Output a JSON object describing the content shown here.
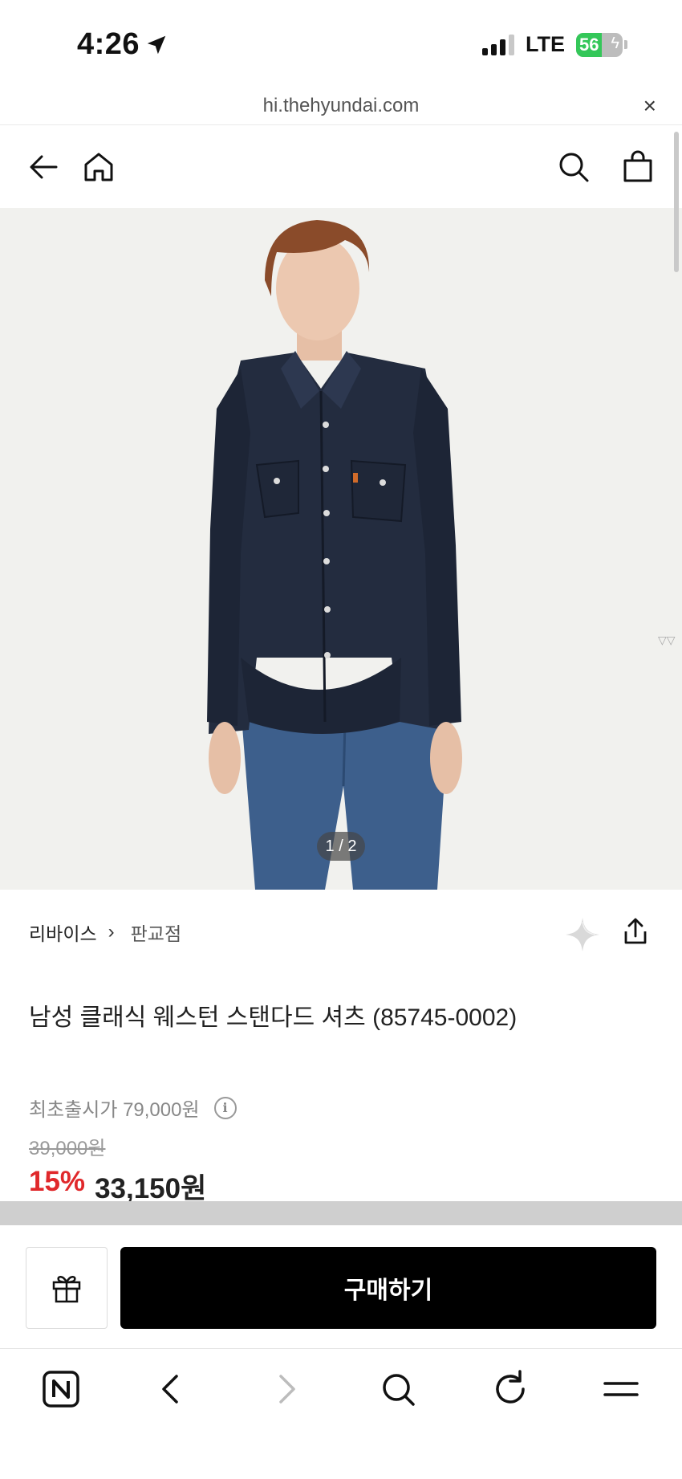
{
  "status_bar": {
    "time": "4:26",
    "network": "LTE",
    "battery_percent": "56",
    "battery_level": 0.56
  },
  "browser": {
    "url": "hi.thehyundai.com",
    "close_glyph": "×"
  },
  "header": {
    "icons": [
      "back-arrow-icon",
      "home-icon",
      "search-icon",
      "shopping-bag-icon"
    ]
  },
  "gallery": {
    "counter": "1 / 2",
    "current": 1,
    "total": 2
  },
  "product": {
    "brand": "리바이스",
    "store": "판교점",
    "title": "남성 클래식 웨스턴 스탠다드 셔츠 (85745-0002)",
    "original_price_label": "최초출시가 79,000원",
    "list_price": "39,000원",
    "discount": "15%",
    "sale_price": "33,150원"
  },
  "actions": {
    "buy_label": "구매하기",
    "gift_icon": "gift-icon"
  },
  "toolbar": {
    "icons": [
      "naver-n-icon",
      "back-chevron-icon",
      "forward-chevron-icon",
      "search-icon",
      "reload-icon",
      "menu-icon"
    ]
  },
  "colors": {
    "discount": "#e0282b",
    "buy_button": "#000000",
    "battery_fill": "#34c759"
  }
}
